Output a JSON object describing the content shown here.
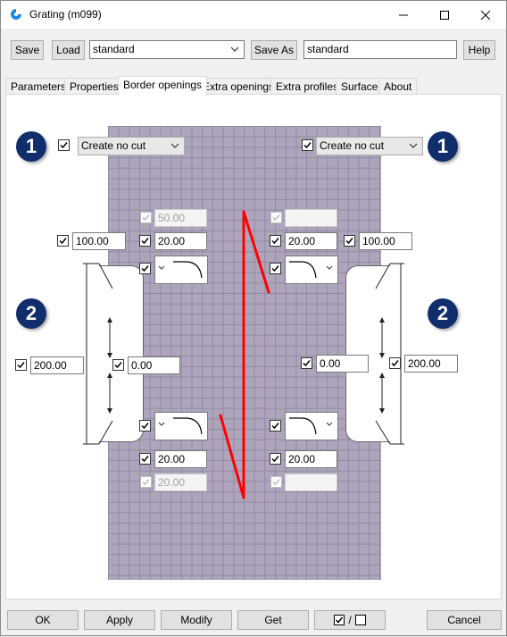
{
  "window": {
    "title": "Grating (m099)"
  },
  "toolbar": {
    "save": "Save",
    "load": "Load",
    "preset": "standard",
    "save_as": "Save As",
    "save_as_name": "standard",
    "help": "Help"
  },
  "tabs": [
    "Parameters",
    "Properties",
    "Border openings",
    "Extra openings",
    "Extra profiles",
    "Surface",
    "About"
  ],
  "active_tab": "Border openings",
  "badges": {
    "one": "1",
    "two": "2"
  },
  "cut_left": "Create no cut",
  "cut_right": "Create no cut",
  "values": {
    "top_left_disabled": "50.00",
    "top_right_disabled": "",
    "left_outer": "100.00",
    "left_inner": "20.00",
    "right_inner": "20.00",
    "right_outer": "100.00",
    "left_height": "200.00",
    "left_offset": "0.00",
    "right_offset": "0.00",
    "right_height": "200.00",
    "bottom_left": "20.00",
    "bottom_right": "20.00",
    "bottom_left_disabled": "20.00",
    "bottom_right_disabled": ""
  },
  "footer": {
    "ok": "OK",
    "apply": "Apply",
    "modify": "Modify",
    "get": "Get",
    "toggle_sep": "/",
    "cancel": "Cancel"
  },
  "colors": {
    "grating": "#aea5bd",
    "badge": "#0f2e6b",
    "arrow": "#ff0000"
  }
}
